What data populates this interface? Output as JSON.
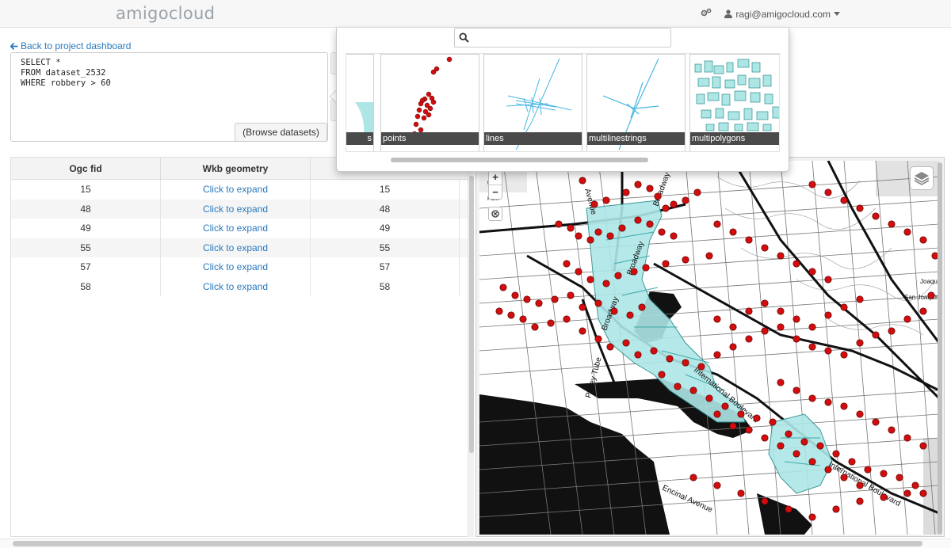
{
  "navbar": {
    "brand": "amigocloud",
    "user_email": "ragi@amigocloud.com"
  },
  "query": {
    "back_label": "Back to project dashboard",
    "sql_text": "SELECT *\nFROM dataset_2532\nWHERE robbery > 60",
    "browse_label": "(Browse datasets)"
  },
  "table": {
    "columns": [
      "Ogc fid",
      "Wkb geometry",
      ""
    ],
    "rows": [
      {
        "fid": "15",
        "geom": "Click to expand",
        "third": "15"
      },
      {
        "fid": "48",
        "geom": "Click to expand",
        "third": "48"
      },
      {
        "fid": "49",
        "geom": "Click to expand",
        "third": "49"
      },
      {
        "fid": "55",
        "geom": "Click to expand",
        "third": "55"
      },
      {
        "fid": "57",
        "geom": "Click to expand",
        "third": "57"
      },
      {
        "fid": "58",
        "geom": "Click to expand",
        "third": "58"
      }
    ]
  },
  "dataset_picker": {
    "search_placeholder": "",
    "thumbnails": [
      {
        "label": "s"
      },
      {
        "label": "points"
      },
      {
        "label": "lines"
      },
      {
        "label": "multilinestrings"
      },
      {
        "label": "multipolygons"
      }
    ]
  },
  "map": {
    "zoom_in": "+",
    "zoom_out": "−",
    "labels": {
      "broadway_1": "Broadway",
      "broadway_2": "Broadway",
      "broadway_3": "Broadway",
      "posey_tube": "Posey Tube",
      "international_1": "International Boulevard",
      "international_2": "International Boulevard",
      "encinal": "Encinal Avenue",
      "joaquin_1": "Joaquin",
      "joaquin_2": "San Joaquin",
      "avenue": "Avenue",
      "tonio": "tonio",
      "park": "Park"
    }
  },
  "colors": {
    "link": "#2a7ac0",
    "point": "#d10d0d",
    "polygon": "#aee6e6",
    "line": "#49b7e3"
  }
}
